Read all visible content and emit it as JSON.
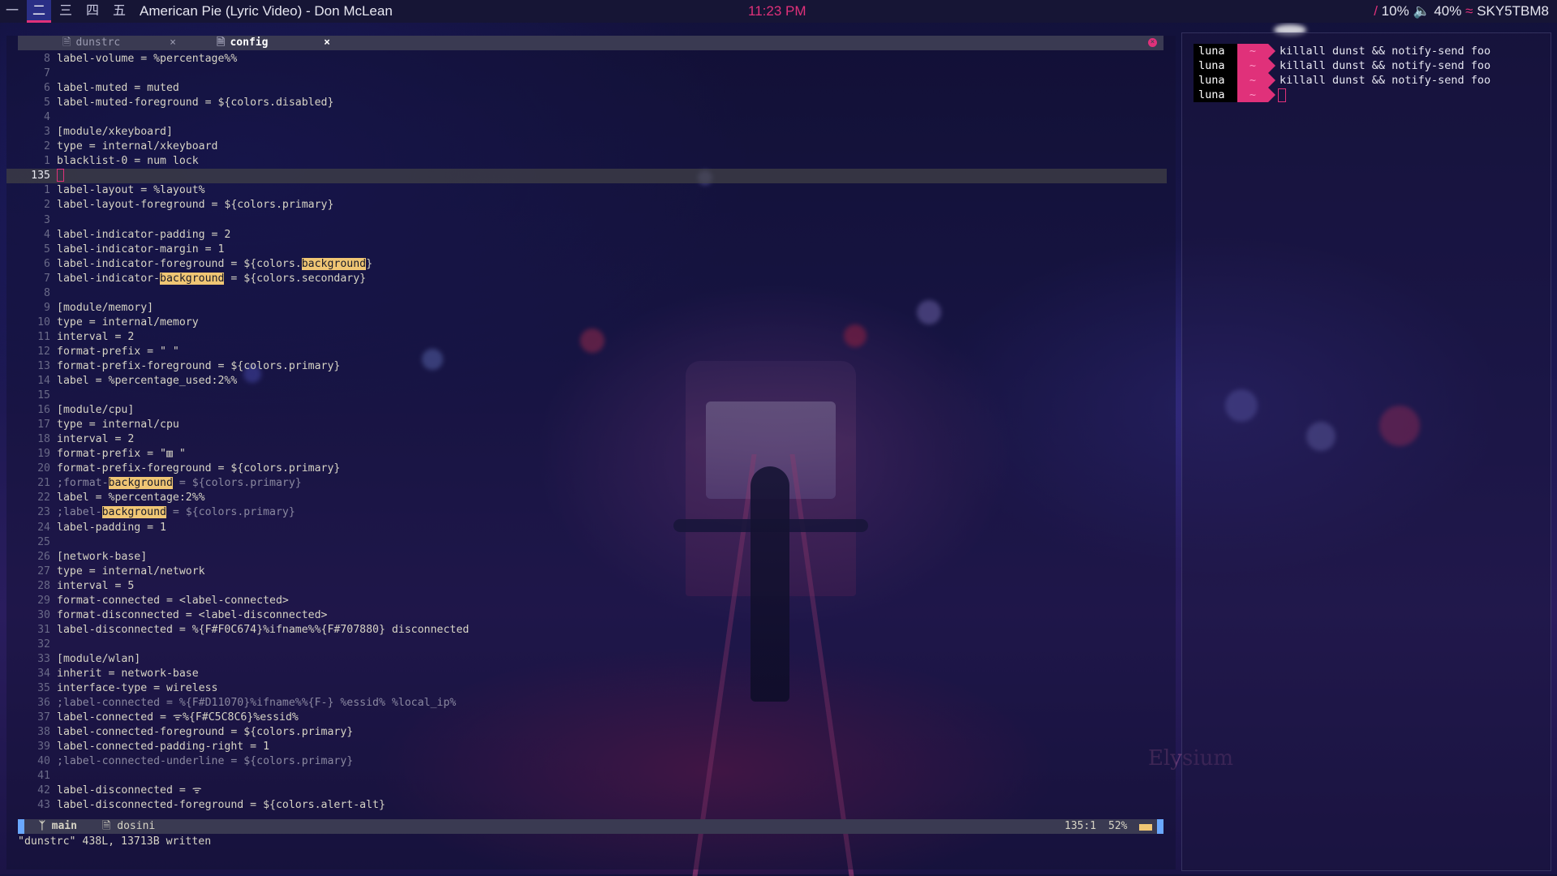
{
  "topbar": {
    "workspaces": [
      "一",
      "二",
      "三",
      "四",
      "五"
    ],
    "active_workspace": 1,
    "window_title": "American Pie (Lyric Video) - Don McLean",
    "clock": "11:23 PM",
    "cpu": "10%",
    "volume": "40%",
    "wifi": "SKY5TBM8",
    "accent_color": "#e0317a"
  },
  "editor": {
    "tabs": [
      {
        "name": "dunstrc",
        "active": false
      },
      {
        "name": "config",
        "active": true
      }
    ],
    "lines": [
      {
        "n": "8",
        "t": "label-volume = %percentage%%"
      },
      {
        "n": "7",
        "t": ""
      },
      {
        "n": "6",
        "t": "label-muted = muted"
      },
      {
        "n": "5",
        "t": "label-muted-foreground = ${colors.disabled}"
      },
      {
        "n": "4",
        "t": ""
      },
      {
        "n": "3",
        "t": "[module/xkeyboard]"
      },
      {
        "n": "2",
        "t": "type = internal/xkeyboard"
      },
      {
        "n": "1",
        "t": "blacklist-0 = num lock"
      },
      {
        "n": "135",
        "t": "",
        "cur": true
      },
      {
        "n": "1",
        "t": "label-layout = %layout%"
      },
      {
        "n": "2",
        "t": "label-layout-foreground = ${colors.primary}"
      },
      {
        "n": "3",
        "t": ""
      },
      {
        "n": "4",
        "t": "label-indicator-padding = 2"
      },
      {
        "n": "5",
        "t": "label-indicator-margin = 1"
      },
      {
        "n": "6",
        "t": "label-indicator-foreground = ${colors.",
        "hl": "background",
        "t2": "}"
      },
      {
        "n": "7",
        "t": "label-indicator-",
        "hl": "background",
        "t2": " = ${colors.secondary}"
      },
      {
        "n": "8",
        "t": ""
      },
      {
        "n": "9",
        "t": "[module/memory]"
      },
      {
        "n": "10",
        "t": "type = internal/memory"
      },
      {
        "n": "11",
        "t": "interval = 2"
      },
      {
        "n": "12",
        "t": "format-prefix = \" \""
      },
      {
        "n": "13",
        "t": "format-prefix-foreground = ${colors.primary}"
      },
      {
        "n": "14",
        "t": "label = %percentage_used:2%%"
      },
      {
        "n": "15",
        "t": ""
      },
      {
        "n": "16",
        "t": "[module/cpu]"
      },
      {
        "n": "17",
        "t": "type = internal/cpu"
      },
      {
        "n": "18",
        "t": "interval = 2"
      },
      {
        "n": "19",
        "t": "format-prefix = \"▥ \""
      },
      {
        "n": "20",
        "t": "format-prefix-foreground = ${colors.primary}"
      },
      {
        "n": "21",
        "t": ";format-",
        "hl": "background",
        "t2": " = ${colors.primary}",
        "dim": true
      },
      {
        "n": "22",
        "t": "label = %percentage:2%%"
      },
      {
        "n": "23",
        "t": ";label-",
        "hl": "background",
        "t2": " = ${colors.primary}",
        "dim": true
      },
      {
        "n": "24",
        "t": "label-padding = 1"
      },
      {
        "n": "25",
        "t": ""
      },
      {
        "n": "26",
        "t": "[network-base]"
      },
      {
        "n": "27",
        "t": "type = internal/network"
      },
      {
        "n": "28",
        "t": "interval = 5"
      },
      {
        "n": "29",
        "t": "format-connected = <label-connected>"
      },
      {
        "n": "30",
        "t": "format-disconnected = <label-disconnected>"
      },
      {
        "n": "31",
        "t": "label-disconnected = %{F#F0C674}%ifname%%{F#707880} disconnected"
      },
      {
        "n": "32",
        "t": ""
      },
      {
        "n": "33",
        "t": "[module/wlan]"
      },
      {
        "n": "34",
        "t": "inherit = network-base"
      },
      {
        "n": "35",
        "t": "interface-type = wireless"
      },
      {
        "n": "36",
        "t": ";label-connected = %{F#D11070}%ifname%%{F-} %essid% %local_ip%",
        "dim": true
      },
      {
        "n": "37",
        "t": "label-connected = ᯤ%{F#C5C8C6}%essid%"
      },
      {
        "n": "38",
        "t": "label-connected-foreground = ${colors.primary}"
      },
      {
        "n": "39",
        "t": "label-connected-padding-right = 1"
      },
      {
        "n": "40",
        "t": ";label-connected-underline = ${colors.primary}",
        "dim": true
      },
      {
        "n": "41",
        "t": ""
      },
      {
        "n": "42",
        "t": "label-disconnected = ᯤ"
      },
      {
        "n": "43",
        "t": "label-disconnected-foreground = ${colors.alert-alt}"
      }
    ],
    "status": {
      "branch": "main",
      "filetype": "dosini",
      "position": "135:1",
      "percent": "52%"
    },
    "message": "\"dunstrc\" 438L, 13713B written"
  },
  "terminal": {
    "lines": [
      {
        "user": "luna",
        "path": "~",
        "cmd": "killall dunst && notify-send foo"
      },
      {
        "user": "luna",
        "path": "~",
        "cmd": "killall dunst && notify-send foo"
      },
      {
        "user": "luna",
        "path": "~",
        "cmd": "killall dunst && notify-send foo"
      },
      {
        "user": "luna",
        "path": "~",
        "cmd": ""
      }
    ]
  },
  "wallpaper": {
    "watermark": "Elysium"
  }
}
